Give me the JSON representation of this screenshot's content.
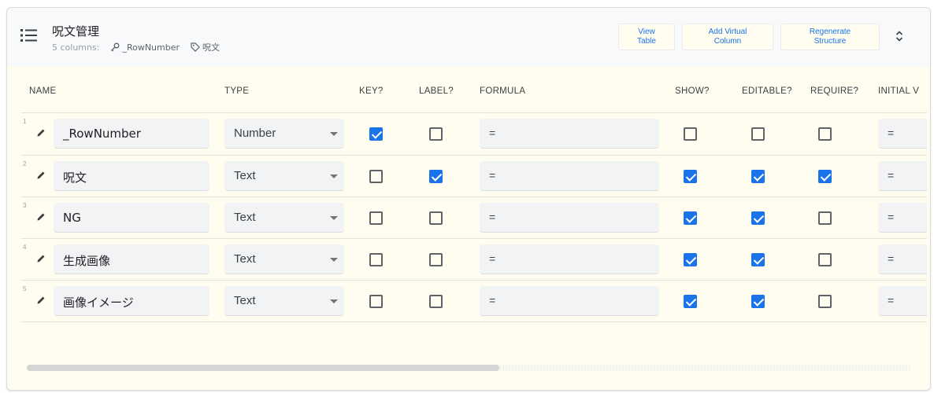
{
  "table": {
    "title": "呪文管理",
    "columns_count": "5 columns:",
    "key_column": "_RowNumber",
    "label_column": "呪文"
  },
  "buttons": {
    "view_table": "View\nTable",
    "add_virtual_column": "Add Virtual\nColumn",
    "regenerate_structure": "Regenerate\nStructure"
  },
  "headers": {
    "name": "NAME",
    "type": "TYPE",
    "key": "KEY?",
    "label": "LABEL?",
    "formula": "FORMULA",
    "show": "SHOW?",
    "editable": "EDITABLE?",
    "require": "REQUIRE?",
    "initial": "INITIAL V"
  },
  "rows": [
    {
      "num": "1",
      "name": "_RowNumber",
      "type": "Number",
      "key": true,
      "label": false,
      "formula": "=",
      "show": false,
      "editable": false,
      "require": false,
      "initial": "="
    },
    {
      "num": "2",
      "name": "呪文",
      "type": "Text",
      "key": false,
      "label": true,
      "formula": "=",
      "show": true,
      "editable": true,
      "require": true,
      "initial": "="
    },
    {
      "num": "3",
      "name": "NG",
      "type": "Text",
      "key": false,
      "label": false,
      "formula": "=",
      "show": true,
      "editable": true,
      "require": false,
      "initial": "="
    },
    {
      "num": "4",
      "name": "生成画像",
      "type": "Text",
      "key": false,
      "label": false,
      "formula": "=",
      "show": true,
      "editable": true,
      "require": false,
      "initial": "="
    },
    {
      "num": "5",
      "name": "画像イメージ",
      "type": "Text",
      "key": false,
      "label": false,
      "formula": "=",
      "show": true,
      "editable": true,
      "require": false,
      "initial": "="
    }
  ],
  "colors": {
    "accent": "#1a73e8",
    "background": "#fefdf0",
    "field": "#f1f3f4"
  },
  "icons": {
    "list": "list-icon",
    "key": "key-icon",
    "label": "tag-icon",
    "edit": "pencil-icon",
    "expand": "unfold-icon"
  }
}
